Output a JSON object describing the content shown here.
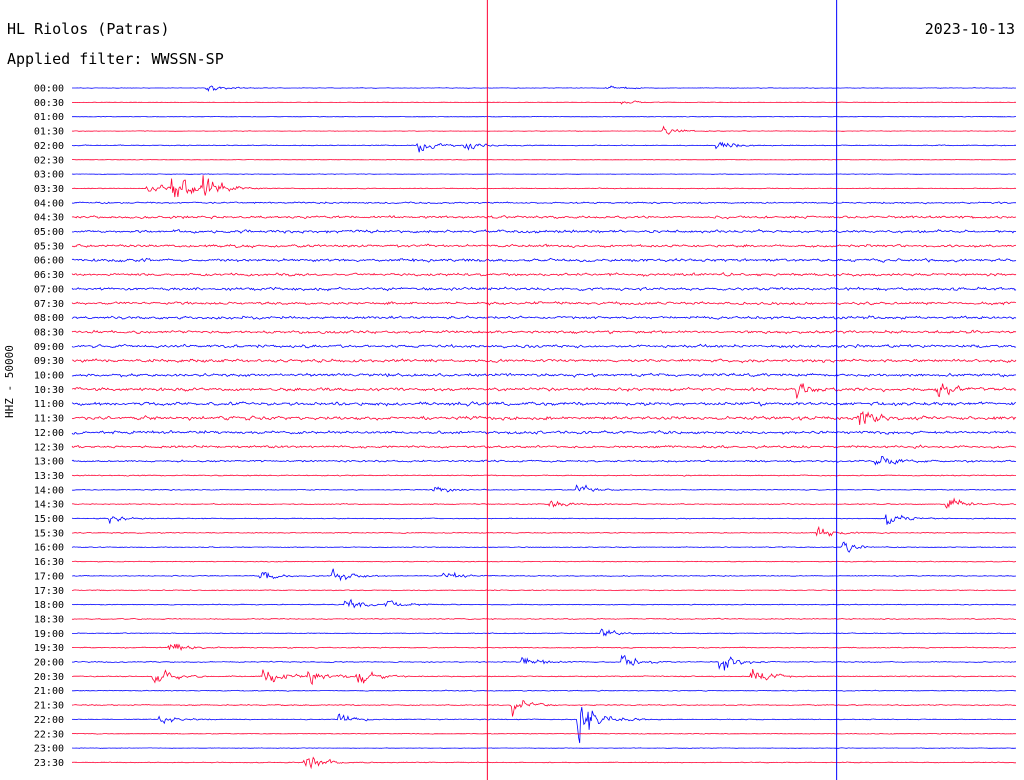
{
  "header": {
    "station": "HL Riolos (Patras)",
    "date": "2023-10-13",
    "filter": "Applied filter: WWSSN-SP",
    "channel": "HHZ - 50000"
  },
  "chart_data": {
    "type": "line",
    "title": "HL Riolos (Patras)",
    "subtitle": "Applied filter: WWSSN-SP",
    "ylabel": "HHZ - 50000",
    "time_labels": [
      "00:00",
      "00:30",
      "01:00",
      "01:30",
      "02:00",
      "02:30",
      "03:00",
      "03:30",
      "04:00",
      "04:30",
      "05:00",
      "05:30",
      "06:00",
      "06:30",
      "07:00",
      "07:30",
      "08:00",
      "08:30",
      "09:00",
      "09:30",
      "10:00",
      "10:30",
      "11:00",
      "11:30",
      "12:00",
      "12:30",
      "13:00",
      "13:30",
      "14:00",
      "14:30",
      "15:00",
      "15:30",
      "16:00",
      "16:30",
      "17:00",
      "17:30",
      "18:00",
      "18:30",
      "19:00",
      "19:30",
      "20:00",
      "20:30",
      "21:00",
      "21:30",
      "22:00",
      "22:30",
      "23:00",
      "23:30"
    ],
    "trace_colors": [
      "#0000ff",
      "#ff0033"
    ],
    "trace_color_order": "alternating, starting blue",
    "noise_level": [
      0.3,
      0.3,
      0.3,
      0.3,
      0.5,
      0.3,
      0.3,
      0.5,
      1.0,
      1.5,
      1.7,
      1.6,
      1.7,
      1.6,
      1.7,
      1.6,
      1.7,
      1.7,
      1.8,
      1.8,
      1.9,
      1.9,
      2.0,
      2.0,
      1.8,
      1.5,
      1.1,
      0.6,
      0.5,
      0.6,
      0.5,
      0.6,
      0.5,
      0.5,
      0.5,
      0.5,
      0.5,
      0.6,
      0.5,
      0.6,
      0.6,
      0.6,
      0.5,
      0.6,
      0.5,
      0.4,
      0.3,
      0.5
    ],
    "marker_lines": [
      {
        "color": "#ff0033",
        "minute_in_trace": 13.2
      },
      {
        "color": "#0000ff",
        "minute_in_trace": 24.3
      }
    ],
    "events": [
      {
        "trace": 0,
        "minute": 4.3,
        "amp": 5
      },
      {
        "trace": 0,
        "minute": 17.0,
        "amp": 4
      },
      {
        "trace": 1,
        "minute": 17.5,
        "amp": 3
      },
      {
        "trace": 3,
        "minute": 18.8,
        "amp": 5
      },
      {
        "trace": 4,
        "minute": 11.0,
        "amp": 10
      },
      {
        "trace": 4,
        "minute": 12.5,
        "amp": 9
      },
      {
        "trace": 4,
        "minute": 20.5,
        "amp": 6
      },
      {
        "trace": 7,
        "minute": 4.2,
        "amp": 16
      },
      {
        "trace": 7,
        "minute": 2.4,
        "amp": 8
      },
      {
        "trace": 7,
        "minute": 3.2,
        "amp": 20
      },
      {
        "trace": 21,
        "minute": 23.0,
        "amp": 12
      },
      {
        "trace": 21,
        "minute": 27.5,
        "amp": 14
      },
      {
        "trace": 23,
        "minute": 25.0,
        "amp": 12
      },
      {
        "trace": 26,
        "minute": 25.5,
        "amp": 12
      },
      {
        "trace": 28,
        "minute": 11.5,
        "amp": 6
      },
      {
        "trace": 28,
        "minute": 16.0,
        "amp": 7
      },
      {
        "trace": 29,
        "minute": 15.2,
        "amp": 6
      },
      {
        "trace": 29,
        "minute": 27.8,
        "amp": 10
      },
      {
        "trace": 30,
        "minute": 1.2,
        "amp": 7
      },
      {
        "trace": 30,
        "minute": 25.9,
        "amp": 9
      },
      {
        "trace": 31,
        "minute": 23.7,
        "amp": 10
      },
      {
        "trace": 32,
        "minute": 24.5,
        "amp": 8
      },
      {
        "trace": 34,
        "minute": 6.0,
        "amp": 8
      },
      {
        "trace": 34,
        "minute": 8.3,
        "amp": 10
      },
      {
        "trace": 34,
        "minute": 11.8,
        "amp": 7
      },
      {
        "trace": 36,
        "minute": 8.7,
        "amp": 9
      },
      {
        "trace": 36,
        "minute": 10.0,
        "amp": 7
      },
      {
        "trace": 38,
        "minute": 16.8,
        "amp": 8
      },
      {
        "trace": 39,
        "minute": 3.1,
        "amp": 8
      },
      {
        "trace": 40,
        "minute": 14.3,
        "amp": 10
      },
      {
        "trace": 40,
        "minute": 17.5,
        "amp": 10
      },
      {
        "trace": 40,
        "minute": 20.6,
        "amp": 12
      },
      {
        "trace": 41,
        "minute": 2.6,
        "amp": 14
      },
      {
        "trace": 41,
        "minute": 6.1,
        "amp": 14
      },
      {
        "trace": 41,
        "minute": 7.5,
        "amp": 12
      },
      {
        "trace": 41,
        "minute": 9.0,
        "amp": 12
      },
      {
        "trace": 41,
        "minute": 21.6,
        "amp": 12
      },
      {
        "trace": 43,
        "minute": 14.0,
        "amp": 12
      },
      {
        "trace": 44,
        "minute": 2.8,
        "amp": 7
      },
      {
        "trace": 44,
        "minute": 8.5,
        "amp": 8
      },
      {
        "trace": 44,
        "minute": 16.1,
        "amp": 40
      },
      {
        "trace": 47,
        "minute": 7.4,
        "amp": 14
      }
    ]
  }
}
